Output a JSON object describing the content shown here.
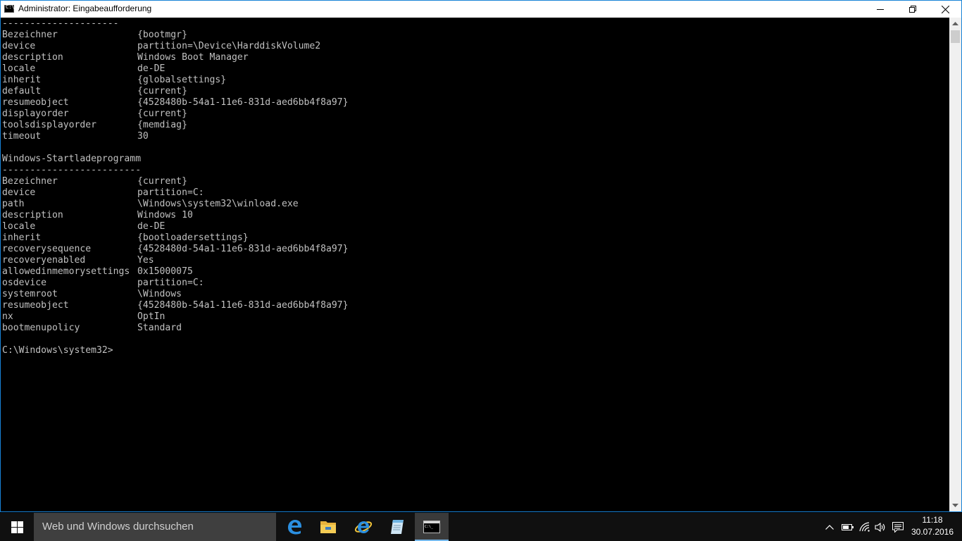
{
  "window": {
    "title": "Administrator: Eingabeaufforderung"
  },
  "console": {
    "lines": [
      {
        "text": "---------------------"
      },
      {
        "key": "Bezeichner",
        "value": "{bootmgr}"
      },
      {
        "key": "device",
        "value": "partition=\\Device\\HarddiskVolume2"
      },
      {
        "key": "description",
        "value": "Windows Boot Manager"
      },
      {
        "key": "locale",
        "value": "de-DE"
      },
      {
        "key": "inherit",
        "value": "{globalsettings}"
      },
      {
        "key": "default",
        "value": "{current}"
      },
      {
        "key": "resumeobject",
        "value": "{4528480b-54a1-11e6-831d-aed6bb4f8a97}"
      },
      {
        "key": "displayorder",
        "value": "{current}"
      },
      {
        "key": "toolsdisplayorder",
        "value": "{memdiag}"
      },
      {
        "key": "timeout",
        "value": "30"
      },
      {
        "text": ""
      },
      {
        "text": "Windows-Startladeprogramm"
      },
      {
        "text": "-------------------------"
      },
      {
        "key": "Bezeichner",
        "value": "{current}"
      },
      {
        "key": "device",
        "value": "partition=C:"
      },
      {
        "key": "path",
        "value": "\\Windows\\system32\\winload.exe"
      },
      {
        "key": "description",
        "value": "Windows 10"
      },
      {
        "key": "locale",
        "value": "de-DE"
      },
      {
        "key": "inherit",
        "value": "{bootloadersettings}"
      },
      {
        "key": "recoverysequence",
        "value": "{4528480d-54a1-11e6-831d-aed6bb4f8a97}"
      },
      {
        "key": "recoveryenabled",
        "value": "Yes"
      },
      {
        "key": "allowedinmemorysettings",
        "value": "0x15000075"
      },
      {
        "key": "osdevice",
        "value": "partition=C:"
      },
      {
        "key": "systemroot",
        "value": "\\Windows"
      },
      {
        "key": "resumeobject",
        "value": "{4528480b-54a1-11e6-831d-aed6bb4f8a97}"
      },
      {
        "key": "nx",
        "value": "OptIn"
      },
      {
        "key": "bootmenupolicy",
        "value": "Standard"
      },
      {
        "text": ""
      },
      {
        "text": "C:\\Windows\\system32>"
      }
    ]
  },
  "taskbar": {
    "search_placeholder": "Web und Windows durchsuchen",
    "apps": [
      {
        "name": "edge-icon"
      },
      {
        "name": "file-explorer-icon"
      },
      {
        "name": "internet-explorer-icon"
      },
      {
        "name": "notes-app-icon"
      },
      {
        "name": "command-prompt-icon",
        "active": true
      }
    ],
    "clock": {
      "time": "11:18",
      "date": "30.07.2016"
    }
  },
  "colors": {
    "console_text": "#c0c0c0",
    "console_bg": "#000000",
    "taskbar_bg": "#101010",
    "window_border": "#1883d7",
    "accent": "#76b9ed"
  }
}
